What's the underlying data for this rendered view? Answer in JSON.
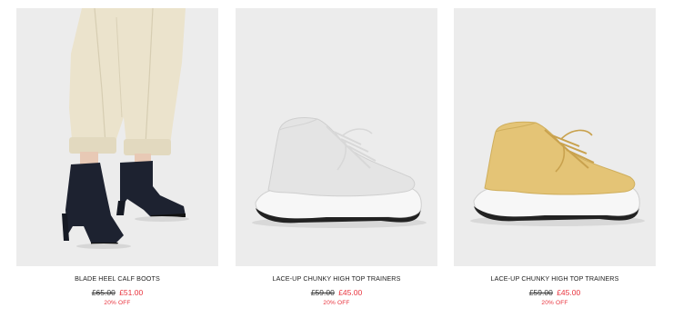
{
  "products": [
    {
      "name": "BLADE HEEL CALF BOOTS",
      "was_price": "£65.00",
      "now_price": "£51.00",
      "discount": "20% OFF",
      "image": "model-wearing-black-boots-cream-trousers"
    },
    {
      "name": "LACE-UP CHUNKY HIGH TOP TRAINERS",
      "was_price": "£59.00",
      "now_price": "£45.00",
      "discount": "20% OFF",
      "image": "white-high-top-trainer",
      "shoe_color": "#e6e6e6"
    },
    {
      "name": "LACE-UP CHUNKY HIGH TOP TRAINERS",
      "was_price": "£59.00",
      "now_price": "£45.00",
      "discount": "20% OFF",
      "image": "yellow-high-top-trainer",
      "shoe_color": "#e4c476"
    }
  ],
  "colors": {
    "sale_red": "#e8323c",
    "image_bg": "#ececec"
  }
}
